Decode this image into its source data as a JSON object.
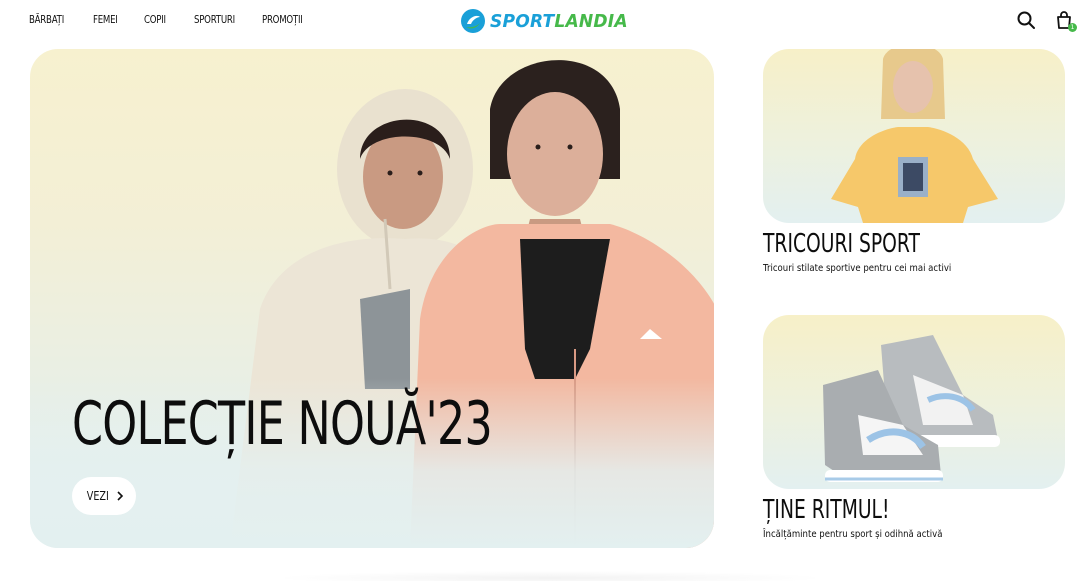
{
  "header": {
    "nav": [
      {
        "label": "BĂRBAȚI"
      },
      {
        "label": "FEMEI"
      },
      {
        "label": "COPII"
      },
      {
        "label": "SPORTURI"
      },
      {
        "label": "PROMOȚII"
      }
    ],
    "logo": {
      "part1": "SPORT",
      "part2": "LANDIA"
    },
    "cart_count": "1",
    "icons": {
      "search": "search-icon",
      "cart": "shopping-bag-icon"
    }
  },
  "hero": {
    "title": "COLECȚIE NOUĂ'23",
    "button_label": "VEZI"
  },
  "cards": [
    {
      "title": "TRICOURI SPORT",
      "subtitle": "Tricouri stilate sportive pentru cei mai activi"
    },
    {
      "title": "ȚINE RITMUL!",
      "subtitle": "Încălțăminte pentru sport și odihnă activă"
    }
  ],
  "colors": {
    "brand_blue": "#1aa0d8",
    "brand_green": "#46b94a",
    "hero_bg_top": "#f7f1cf",
    "hero_bg_bottom": "#e3f0f0"
  }
}
